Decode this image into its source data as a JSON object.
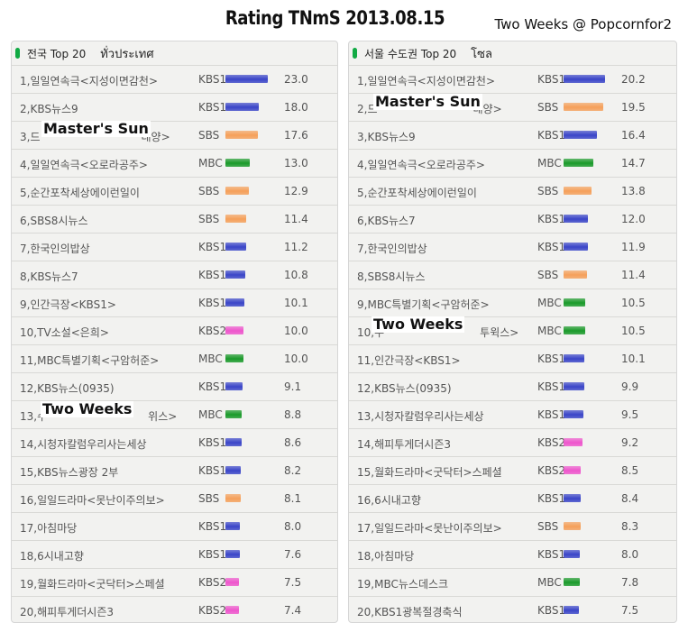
{
  "title": "Rating TNmS 2013.08.15",
  "credit": "Two Weeks @ Popcornfor2",
  "colors": {
    "KBS1": "#3a45c8",
    "KBS2": "#ee55cc",
    "MBC": "#1a9a2a",
    "SBS": "#f5a05a"
  },
  "overlays": {
    "nation_row3": "Master's Sun",
    "nation_row13": "Two Weeks",
    "seoul_row2": "Master's Sun",
    "seoul_row10": "Two Weeks"
  },
  "chart_data": [
    {
      "type": "bar",
      "header": {
        "label": "전국 Top 20",
        "sub": "ทั่วประเทศ"
      },
      "xlim": [
        0,
        23.0
      ],
      "rows": [
        {
          "rank": "1",
          "name": "일일연속극<지성이면감천>",
          "channel": "KBS1",
          "value": 23.0
        },
        {
          "rank": "2",
          "name": "KBS뉴스9",
          "channel": "KBS1",
          "value": 18.0
        },
        {
          "rank": "3",
          "name": "드",
          "tail": "태양>",
          "channel": "SBS",
          "value": 17.6
        },
        {
          "rank": "4",
          "name": "일일연속극<오로라공주>",
          "channel": "MBC",
          "value": 13.0
        },
        {
          "rank": "5",
          "name": "순간포착세상에이런일이",
          "channel": "SBS",
          "value": 12.9
        },
        {
          "rank": "6",
          "name": "SBS8시뉴스",
          "channel": "SBS",
          "value": 11.4
        },
        {
          "rank": "7",
          "name": "한국인의밥상",
          "channel": "KBS1",
          "value": 11.2
        },
        {
          "rank": "8",
          "name": "KBS뉴스7",
          "channel": "KBS1",
          "value": 10.8
        },
        {
          "rank": "9",
          "name": "인간극장<KBS1>",
          "channel": "KBS1",
          "value": 10.1
        },
        {
          "rank": "10",
          "name": "TV소설<은희>",
          "channel": "KBS2",
          "value": 10.0
        },
        {
          "rank": "11",
          "name": "MBC특별기획<구암허준>",
          "channel": "MBC",
          "value": 10.0
        },
        {
          "rank": "12",
          "name": "KBS뉴스(0935)",
          "channel": "KBS1",
          "value": 9.1
        },
        {
          "rank": "13",
          "name": "수",
          "tail": "위스>",
          "channel": "MBC",
          "value": 8.8
        },
        {
          "rank": "14",
          "name": "시청자칼럼우리사는세상",
          "channel": "KBS1",
          "value": 8.6
        },
        {
          "rank": "15",
          "name": "KBS뉴스광장 2부",
          "channel": "KBS1",
          "value": 8.2
        },
        {
          "rank": "16",
          "name": "일일드라마<못난이주의보>",
          "channel": "SBS",
          "value": 8.1
        },
        {
          "rank": "17",
          "name": "아침마당",
          "channel": "KBS1",
          "value": 8.0
        },
        {
          "rank": "18",
          "name": "6시내고향",
          "channel": "KBS1",
          "value": 7.6
        },
        {
          "rank": "19",
          "name": "월화드라마<굿닥터>스페셜",
          "channel": "KBS2",
          "value": 7.5
        },
        {
          "rank": "20",
          "name": "해피투게더시즌3",
          "channel": "KBS2",
          "value": 7.4
        }
      ]
    },
    {
      "type": "bar",
      "header": {
        "label": "서울 수도권 Top 20",
        "sub": "โซล"
      },
      "xlim": [
        0,
        20.2
      ],
      "rows": [
        {
          "rank": "1",
          "name": "일일연속극<지성이면감천>",
          "channel": "KBS1",
          "value": 20.2
        },
        {
          "rank": "2",
          "name": "드",
          "tail": "태양>",
          "channel": "SBS",
          "value": 19.5
        },
        {
          "rank": "3",
          "name": "KBS뉴스9",
          "channel": "KBS1",
          "value": 16.4
        },
        {
          "rank": "4",
          "name": "일일연속극<오로라공주>",
          "channel": "MBC",
          "value": 14.7
        },
        {
          "rank": "5",
          "name": "순간포착세상에이런일이",
          "channel": "SBS",
          "value": 13.8
        },
        {
          "rank": "6",
          "name": "KBS뉴스7",
          "channel": "KBS1",
          "value": 12.0
        },
        {
          "rank": "7",
          "name": "한국인의밥상",
          "channel": "KBS1",
          "value": 11.9
        },
        {
          "rank": "8",
          "name": "SBS8시뉴스",
          "channel": "SBS",
          "value": 11.4
        },
        {
          "rank": "9",
          "name": "MBC특별기획<구암허준>",
          "channel": "MBC",
          "value": 10.5
        },
        {
          "rank": "10",
          "name": "수",
          "tail": "투윅스>",
          "channel": "MBC",
          "value": 10.5
        },
        {
          "rank": "11",
          "name": "인간극장<KBS1>",
          "channel": "KBS1",
          "value": 10.1
        },
        {
          "rank": "12",
          "name": "KBS뉴스(0935)",
          "channel": "KBS1",
          "value": 9.9
        },
        {
          "rank": "13",
          "name": "시청자칼럼우리사는세상",
          "channel": "KBS1",
          "value": 9.5
        },
        {
          "rank": "14",
          "name": "해피투게더시즌3",
          "channel": "KBS2",
          "value": 9.2
        },
        {
          "rank": "15",
          "name": "월화드라마<굿닥터>스페셜",
          "channel": "KBS2",
          "value": 8.5
        },
        {
          "rank": "16",
          "name": "6시내고향",
          "channel": "KBS1",
          "value": 8.4
        },
        {
          "rank": "17",
          "name": "일일드라마<못난이주의보>",
          "channel": "SBS",
          "value": 8.3
        },
        {
          "rank": "18",
          "name": "아침마당",
          "channel": "KBS1",
          "value": 8.0
        },
        {
          "rank": "19",
          "name": "MBC뉴스데스크",
          "channel": "MBC",
          "value": 7.8
        },
        {
          "rank": "20",
          "name": "KBS1광복절경축식",
          "channel": "KBS1",
          "value": 7.5
        }
      ]
    }
  ]
}
